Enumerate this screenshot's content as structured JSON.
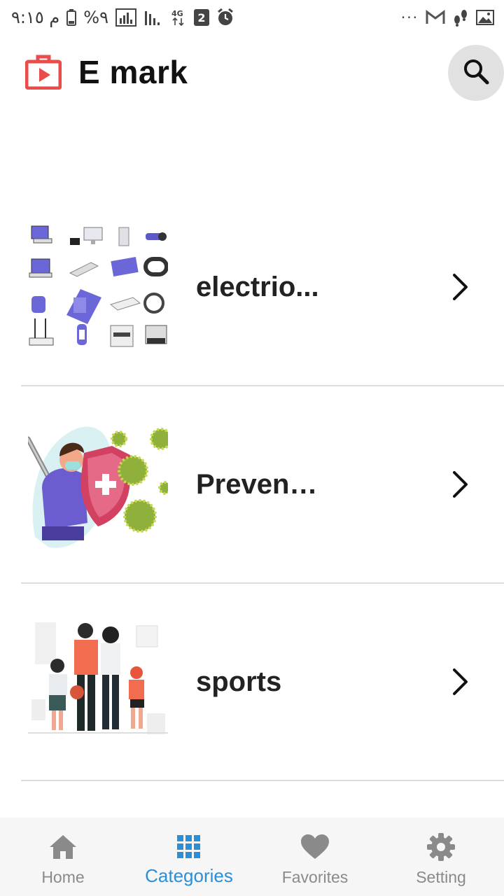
{
  "status_bar": {
    "time": "م ٩:١٥",
    "battery": "%٩",
    "network": "4G",
    "sim_badge": "2",
    "overflow": "···"
  },
  "app_bar": {
    "title": "E mark",
    "logo_icon": "shopping-bag-play-icon",
    "search_icon": "search-icon",
    "accent": "#ea4c4c"
  },
  "categories": [
    {
      "label": "electrio...",
      "image": "electronics-illustration",
      "chevron": "chevron-right-icon"
    },
    {
      "label": "Prevent...",
      "image": "prevention-illustration",
      "chevron": "chevron-right-icon"
    },
    {
      "label": "sports",
      "image": "sports-family-illustration",
      "chevron": "chevron-right-icon"
    }
  ],
  "bottom_nav": {
    "items": [
      {
        "label": "Home",
        "icon": "home-icon",
        "active": false
      },
      {
        "label": "Categories",
        "icon": "grid-icon",
        "active": true
      },
      {
        "label": "Favorites",
        "icon": "heart-icon",
        "active": false
      },
      {
        "label": "Setting",
        "icon": "gear-icon",
        "active": false
      }
    ],
    "active_color": "#2a8fd8",
    "inactive_color": "#8a8a8a"
  }
}
